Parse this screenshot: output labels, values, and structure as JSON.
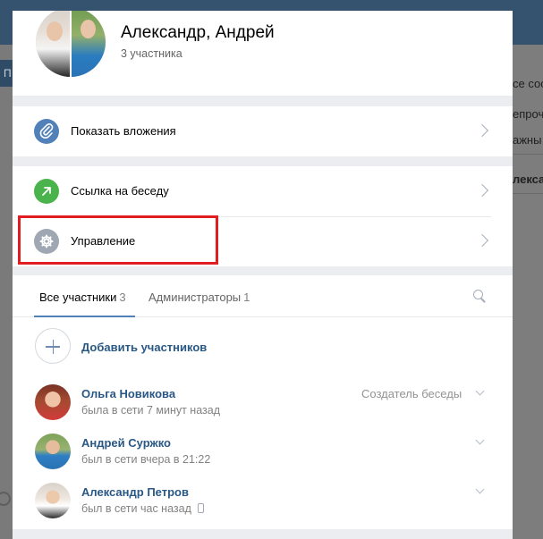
{
  "background": {
    "topbar_tab_text": "П",
    "right_fragments": [
      "се сооб",
      "епрочи",
      "ажны",
      "лекса"
    ]
  },
  "header": {
    "title": "Александр, Андрей",
    "subtitle": "3 участника"
  },
  "menu": {
    "attachments_label": "Показать вложения",
    "link_label": "Ссылка на беседу",
    "manage_label": "Управление"
  },
  "members_block": {
    "tabs": [
      {
        "label": "Все участники",
        "count": "3"
      },
      {
        "label": "Администраторы",
        "count": "1"
      }
    ],
    "add_label": "Добавить участников",
    "members": [
      {
        "name": "Ольга Новикова",
        "status": "была в сети 7 минут назад",
        "role": "Создатель беседы"
      },
      {
        "name": "Андрей Суржко",
        "status": "был в сети вчера в 21:22",
        "role": ""
      },
      {
        "name": "Александр Петров",
        "status": "был в сети час назад",
        "role": ""
      }
    ]
  },
  "colors": {
    "accent": "#5181b8",
    "link": "#2a5885",
    "highlight": "#e01e22",
    "attach_icon": "#5181b8",
    "link_icon": "#4bb34b",
    "gear_icon": "#9fa7b2"
  },
  "icons": [
    "paperclip-icon",
    "arrow-up-right-icon",
    "gear-icon",
    "chevron-right-icon",
    "search-icon",
    "plus-icon",
    "chevron-down-icon",
    "phone-icon"
  ]
}
